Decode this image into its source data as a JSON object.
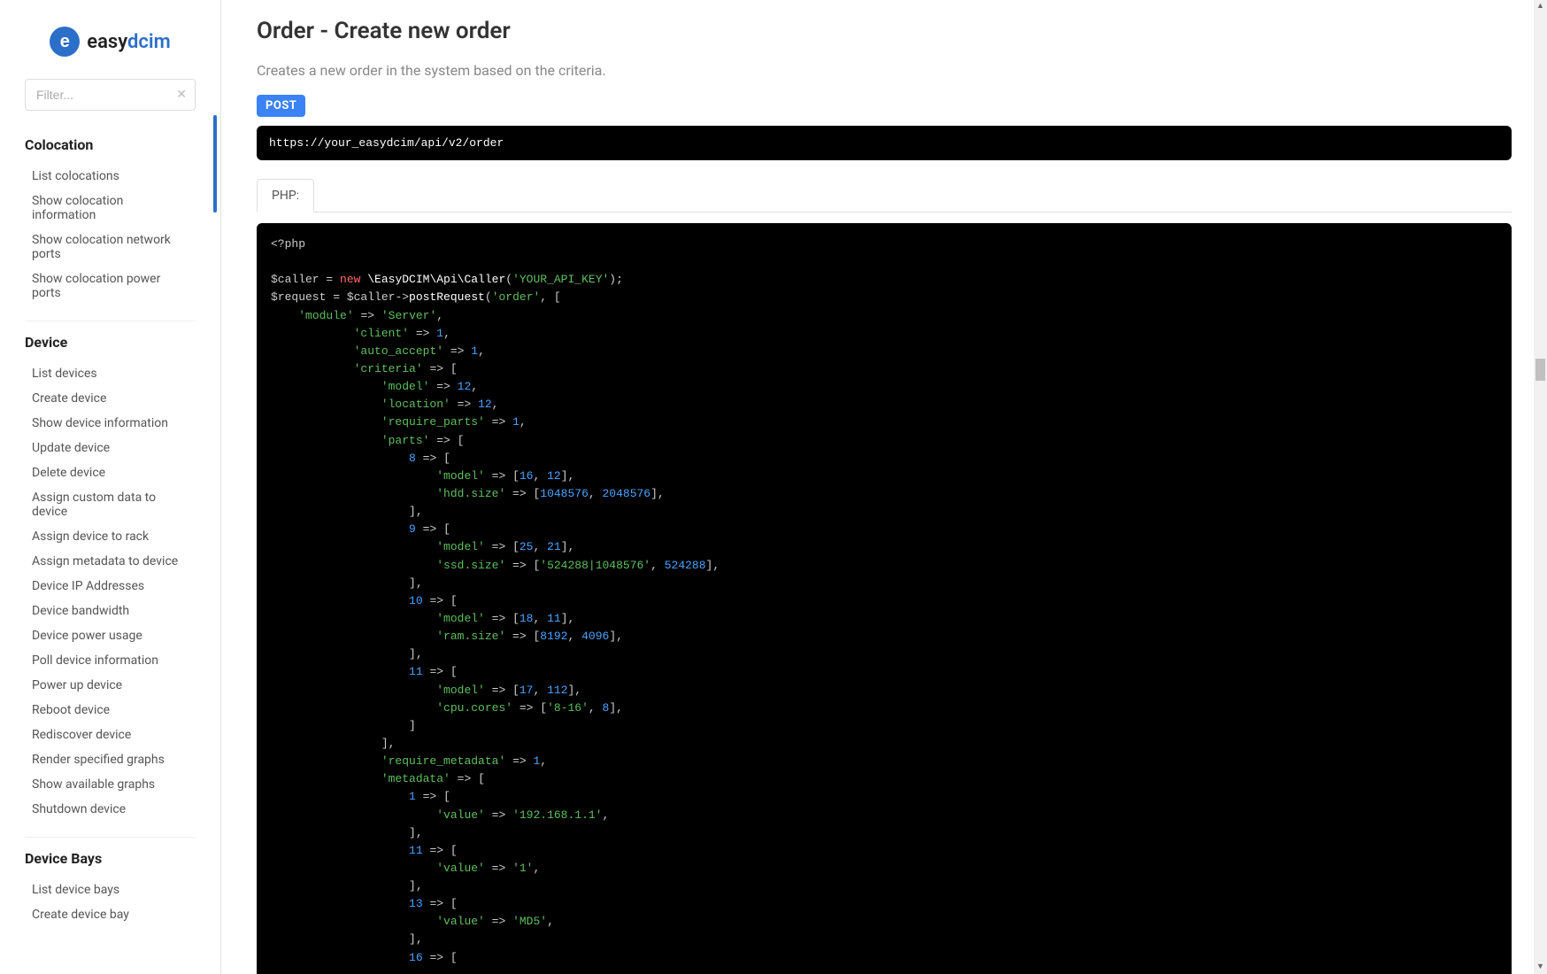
{
  "brand": {
    "name_a": "easy",
    "name_b": "dcim",
    "icon_letter": "e"
  },
  "filter": {
    "placeholder": "Filter..."
  },
  "sidebar": {
    "sections": [
      {
        "title": "Colocation",
        "items": [
          "List colocations",
          "Show colocation information",
          "Show colocation network ports",
          "Show colocation power ports"
        ]
      },
      {
        "title": "Device",
        "items": [
          "List devices",
          "Create device",
          "Show device information",
          "Update device",
          "Delete device",
          "Assign custom data to device",
          "Assign device to rack",
          "Assign metadata to device",
          "Device IP Addresses",
          "Device bandwidth",
          "Device power usage",
          "Poll device information",
          "Power up device",
          "Reboot device",
          "Rediscover device",
          "Render specified graphs",
          "Show available graphs",
          "Shutdown device"
        ]
      },
      {
        "title": "Device Bays",
        "items": [
          "List device bays",
          "Create device bay"
        ]
      }
    ]
  },
  "page": {
    "title": "Order - Create new order",
    "description": "Creates a new order in the system based on the criteria.",
    "method": "POST",
    "endpoint": "https://your_easydcim/api/v2/order",
    "tab": "PHP:"
  },
  "code": {
    "php_open": "<?php",
    "var_caller": "$caller",
    "eq": " = ",
    "kw_new": "new",
    "sp": " ",
    "cls_caller": "\\EasyDCIM\\Api\\Caller",
    "paren_open": "(",
    "str_api_key": "'YOUR_API_KEY'",
    "paren_close_semi": ");",
    "var_request": "$request",
    "arrow": "->",
    "fn_post": "postRequest",
    "str_order": "'order'",
    "comma_sp": ", ",
    "bracket_open": "[",
    "indent1": "        ",
    "indent2": "                ",
    "indent3": "                        ",
    "indent4": "                ",
    "k_module": "'module'",
    "arrow_fat": " => ",
    "v_server": "'Server'",
    "comma": ",",
    "k_client": "'client'",
    "n1": "1",
    "k_auto_accept": "'auto_accept'",
    "k_criteria": "'criteria'",
    "k_model": "'model'",
    "n12": "12",
    "k_location": "'location'",
    "k_require_parts": "'require_parts'",
    "k_parts": "'parts'",
    "n8": "8",
    "n16": "16",
    "k_hdd_size": "'hdd.size'",
    "n1048576": "1048576",
    "n2048576": "2048576",
    "close_bracket_comma": "],",
    "n9": "9",
    "n25": "25",
    "n21": "21",
    "k_ssd_size": "'ssd.size'",
    "s_524288_1048576": "'524288|1048576'",
    "n524288": "524288",
    "n10": "10",
    "n18": "18",
    "n11": "11",
    "k_ram_size": "'ram.size'",
    "n8192": "8192",
    "n4096": "4096",
    "n17": "17",
    "n112": "112",
    "k_cpu_cores": "'cpu.cores'",
    "s_8_16": "'8-16'",
    "close_bracket": "]",
    "k_require_metadata": "'require_metadata'",
    "k_metadata": "'metadata'",
    "k_value": "'value'",
    "s_ip": "'192.168.1.1'",
    "s_1": "'1'",
    "n13": "13",
    "s_md5": "'MD5'"
  }
}
